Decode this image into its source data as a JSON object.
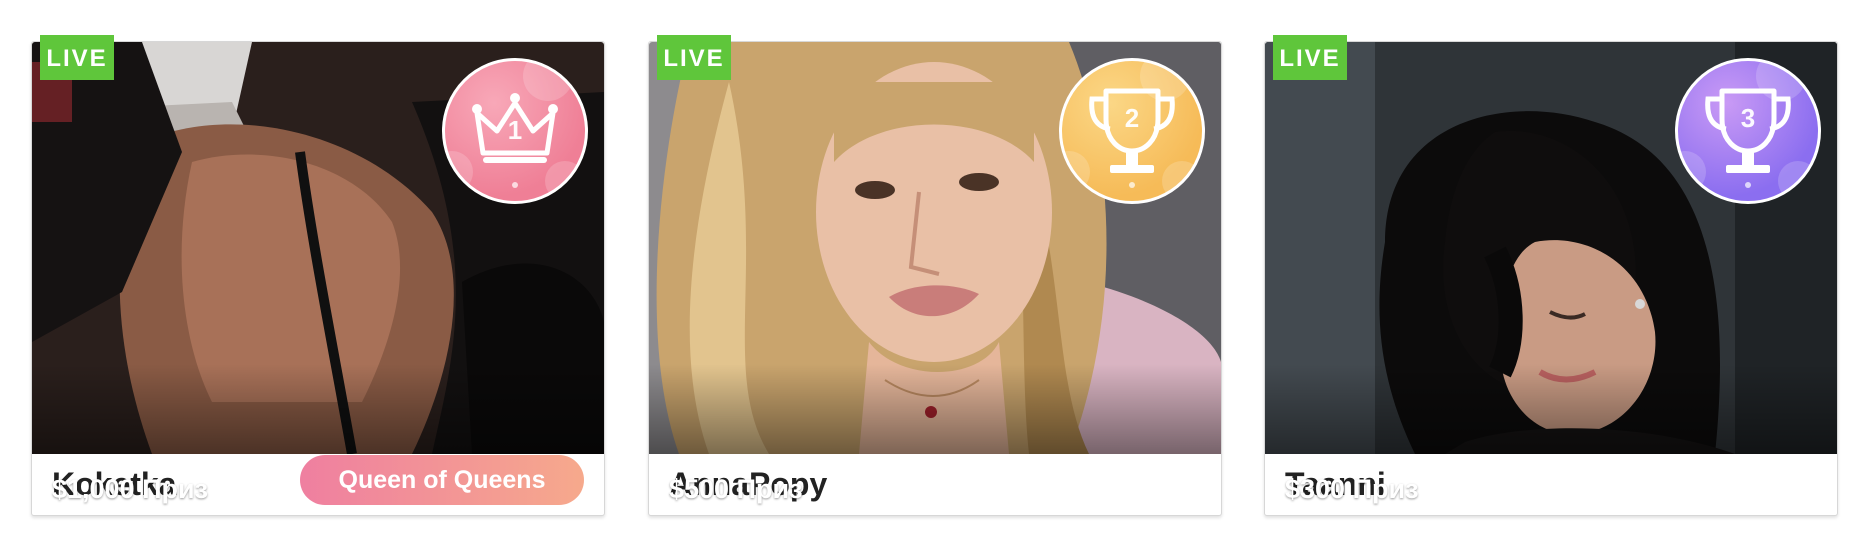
{
  "cards": [
    {
      "live": "LIVE",
      "rank": "1",
      "medal_icon": "crown-icon",
      "medal_color": "#ef7f96",
      "prize": "$1,000 Приз",
      "tag": "Queen of Queens",
      "name": "Koketka"
    },
    {
      "live": "LIVE",
      "rank": "2",
      "medal_icon": "trophy-icon",
      "medal_color": "#f6bb58",
      "prize": "$500 Приз",
      "name": "AnnaPopy"
    },
    {
      "live": "LIVE",
      "rank": "3",
      "medal_icon": "trophy-icon",
      "medal_color": "#8b6ef0",
      "prize": "$300 Приз",
      "name": "Taanni"
    }
  ],
  "colors": {
    "live_badge": "#5fc63b",
    "queen_tag_start": "#ef7fa0",
    "queen_tag_end": "#f6a98c"
  }
}
